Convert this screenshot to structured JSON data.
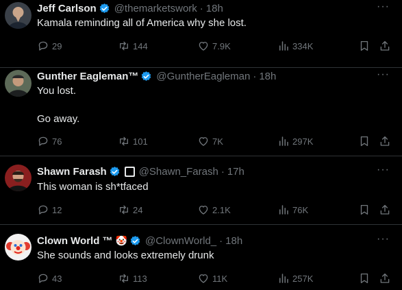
{
  "tweets": [
    {
      "name": "Jeff Carlson",
      "handle": "@themarketswork",
      "time": "18h",
      "text_lines": [
        "Kamala reminding all of America why she lost."
      ],
      "replies": "29",
      "reposts": "144",
      "likes": "7.9K",
      "views": "334K",
      "more": "···"
    },
    {
      "name": "Gunther Eagleman™",
      "handle": "@GuntherEagleman",
      "time": "18h",
      "text_lines": [
        "You lost.",
        "Go away."
      ],
      "replies": "76",
      "reposts": "101",
      "likes": "7K",
      "views": "297K",
      "more": "···"
    },
    {
      "name": "Shawn Farash",
      "handle": "@Shawn_Farash",
      "time": "17h",
      "text_lines": [
        "This woman is sh*tfaced"
      ],
      "replies": "12",
      "reposts": "24",
      "likes": "2.1K",
      "views": "76K",
      "more": "···"
    },
    {
      "name": "Clown World ™",
      "emoji": "🤡",
      "handle": "@ClownWorld_",
      "time": "18h",
      "text_lines": [
        "She sounds and looks extremely drunk"
      ],
      "replies": "43",
      "reposts": "113",
      "likes": "11K",
      "views": "257K",
      "more": "···"
    }
  ],
  "colors": {
    "background": "#000000",
    "text": "#e7e9ea",
    "muted": "#71767b",
    "verified": "#1d9bf0",
    "divider": "#2f3336"
  },
  "icons": {
    "reply": "reply-icon",
    "repost": "repost-icon",
    "like": "heart-icon",
    "views": "views-icon",
    "bookmark": "bookmark-icon",
    "share": "share-icon",
    "verified": "verified-badge-icon",
    "more": "more-icon"
  }
}
